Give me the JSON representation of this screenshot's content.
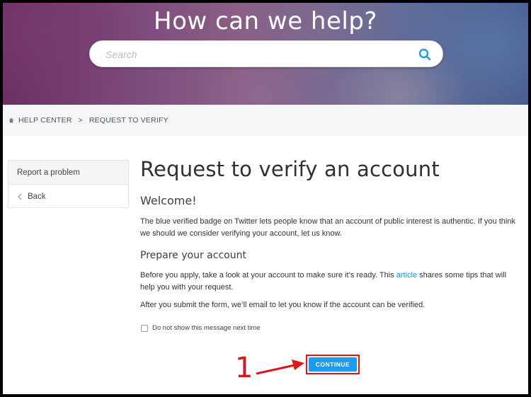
{
  "hero": {
    "title": "How can we help?",
    "search_placeholder": "Search"
  },
  "breadcrumb": {
    "home": "HELP CENTER",
    "separator": ">",
    "current": "REQUEST TO VERIFY"
  },
  "sidebar": {
    "items": [
      {
        "label": "Report a problem"
      },
      {
        "label": "Back",
        "icon": "chevron-left-icon"
      }
    ]
  },
  "main": {
    "title": "Request to verify an account",
    "welcome_heading": "Welcome!",
    "welcome_text": "The blue verified badge on Twitter lets people know that an account of public interest is authentic. If you think we should we consider verifying your account, let us know.",
    "prepare_heading": "Prepare your account",
    "prepare_text_before": "Before you apply, take a look at your account to make sure it’s ready. This ",
    "prepare_link": "article",
    "prepare_text_after": " shares some tips that will help you with your request.",
    "submit_text": "After you submit the form, we’ll email to let you know if the account can be verified.",
    "checkbox_label": "Do not show this message next time",
    "checkbox_checked": false,
    "continue_label": "CONTINUE"
  },
  "annotation": {
    "number": "1",
    "color": "#e0141d"
  },
  "colors": {
    "accent": "#1d9bf0",
    "link": "#1b95e0"
  }
}
